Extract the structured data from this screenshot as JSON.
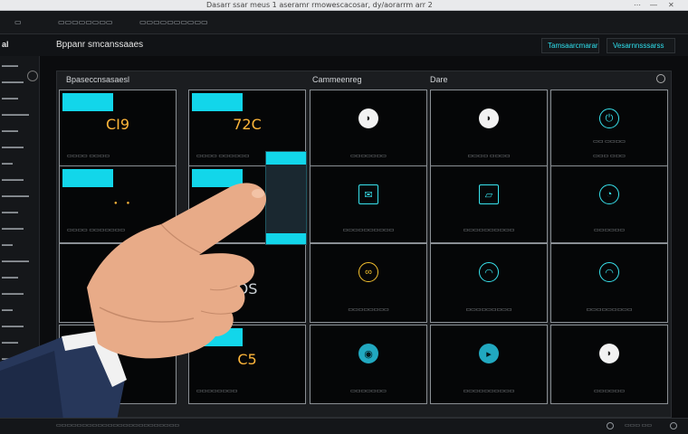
{
  "browser": {
    "url_text": "Dasarr ssar meus 1 aseramr rmowescacosar, dy/aorarrm arr 2",
    "controls": [
      "⋯",
      "—",
      "✕"
    ]
  },
  "tabs": [
    {
      "label": "▭"
    },
    {
      "label": "▭▭▭▭▭▭▭▭"
    },
    {
      "label": "▭▭▭▭▭▭▭▭▭▭"
    }
  ],
  "header": {
    "logo": "al",
    "title": "Bppanr smcanssaaes",
    "button_1": "Tamsaarcmarar",
    "button_2": "Vesarnnsssarss"
  },
  "sidebar": {
    "items": [
      "▬▬▬",
      "▬▬▬▬",
      "▬▬▬",
      "▬▬▬▬▬",
      "▬▬▬",
      "▬▬▬▬",
      "▬▬",
      "▬▬▬▬",
      "▬▬▬▬▬",
      "▬▬▬",
      "▬▬▬▬",
      "▬▬",
      "▬▬▬▬▬",
      "▬▬▬",
      "▬▬▬▬",
      "▬▬",
      "▬▬▬▬",
      "▬▬▬",
      "▬▬▬▬▬",
      "▬▬▬"
    ]
  },
  "panel": {
    "heading_1": "Bpaseccnsasaesl",
    "heading_2": "Cammeenreg",
    "heading_3": "Dare"
  },
  "tiles": [
    {
      "value": "CI9",
      "label": "▭▭▭▭ ▭▭▭▭",
      "icon": ""
    },
    {
      "value": "72C",
      "label": "▭▭▭▭ ▭▭▭▭▭▭",
      "icon": ""
    },
    {
      "value": "",
      "label": "▭▭▭▭▭▭▭",
      "icon": "toggle-icon"
    },
    {
      "value": "",
      "label": "▭▭▭▭ ▭▭▭▭",
      "icon": "toggle-icon"
    },
    {
      "value": "",
      "label": "▭▭▭ ▭▭▭",
      "icon": "power-icon",
      "sub": "▭▭ ▭▭▭▭"
    },
    {
      "value": "",
      "label": "▭▭▭▭ ▭▭▭▭▭▭▭",
      "icon": ""
    },
    {
      "value": "",
      "label": "▭▭▭▭▭",
      "icon": ""
    },
    {
      "value": "",
      "label": "▭▭▭▭▭▭▭▭▭▭",
      "icon": "mail-icon"
    },
    {
      "value": "",
      "label": "▭▭▭▭▭▭▭▭▭▭",
      "icon": "folder-icon"
    },
    {
      "value": "",
      "label": "▭▭▭▭▭▭",
      "icon": "drop-icon"
    },
    {
      "value": "",
      "label": "",
      "icon": ""
    },
    {
      "value": "OS",
      "label": "",
      "icon": ""
    },
    {
      "value": "",
      "label": "▭▭▭▭▭▭▭▭",
      "icon": "link-icon"
    },
    {
      "value": "",
      "label": "▭▭▭▭▭▭▭▭▭",
      "icon": "wifi-icon"
    },
    {
      "value": "",
      "label": "▭▭▭▭▭▭▭▭▭",
      "icon": "wifi-icon"
    },
    {
      "value": "",
      "label": "",
      "icon": ""
    },
    {
      "value": "C5",
      "label": "▭▭▭▭▭▭▭▭",
      "icon": ""
    },
    {
      "value": "",
      "label": "▭▭▭▭▭▭▭",
      "icon": "target-icon"
    },
    {
      "value": "",
      "label": "▭▭▭▭▭▭▭▭▭▭",
      "icon": "play-icon"
    },
    {
      "value": "",
      "label": "▭▭▭▭▭▭",
      "icon": "toggle-icon"
    }
  ],
  "status": {
    "left_text": "▭▭▭▭▭▭▭▭▭▭▭▭▭▭▭▭▭▭▭▭▭▭▭▭",
    "right_text": "▭▭▭ ▭▭"
  },
  "colors": {
    "accent_cyan": "#12d6ea",
    "value_amber": "#ffb63a",
    "background": "#0b0c0e"
  }
}
